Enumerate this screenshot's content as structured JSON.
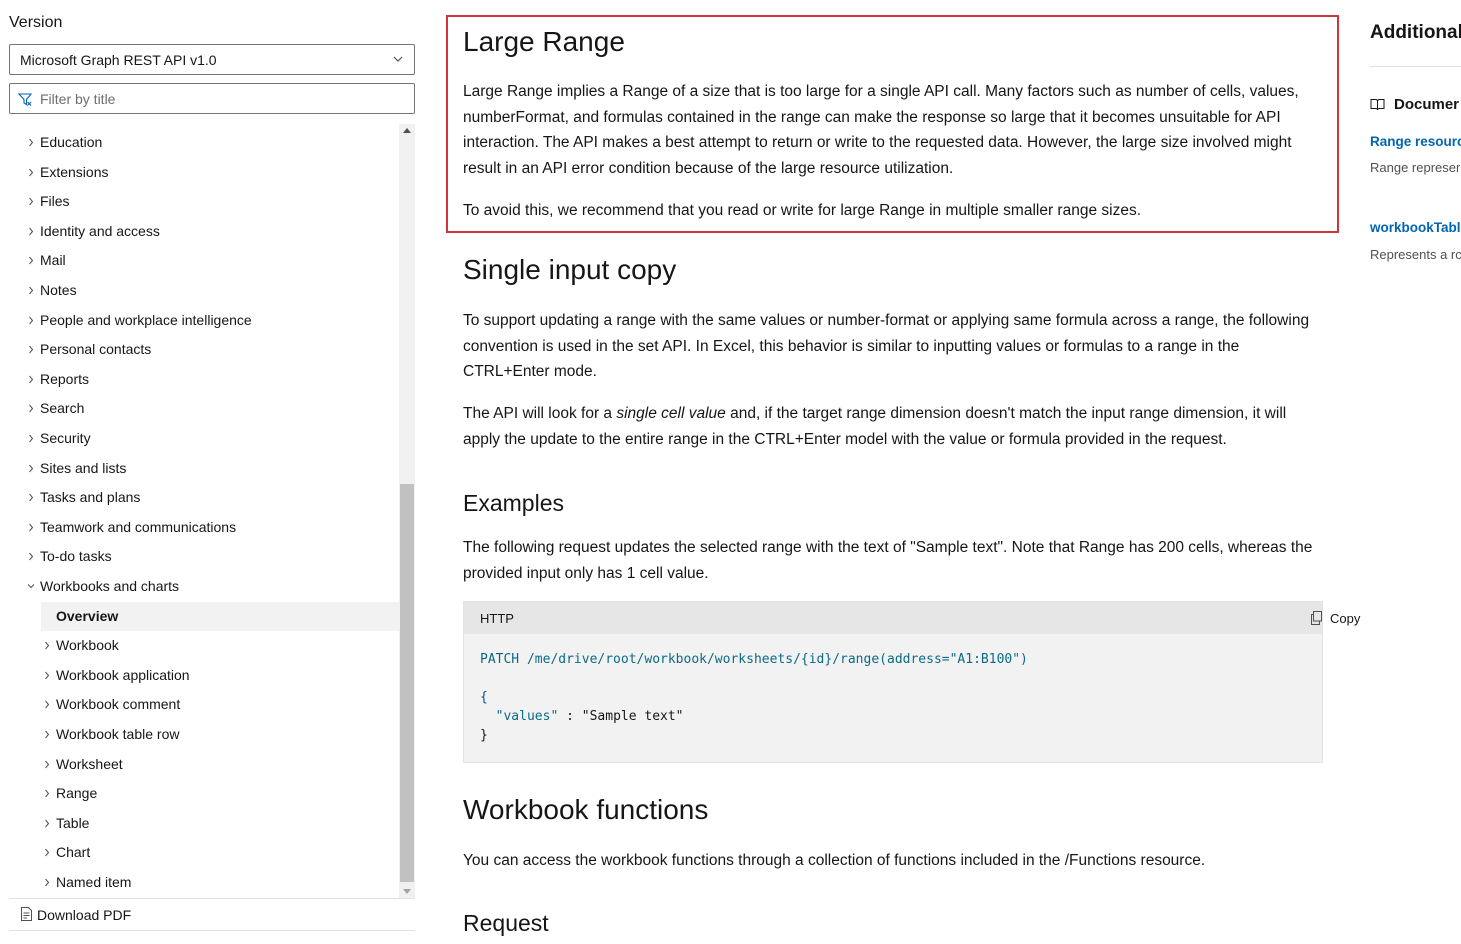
{
  "sidebar": {
    "version_label": "Version",
    "version_selected": "Microsoft Graph REST API v1.0",
    "filter_placeholder": "Filter by title",
    "toc": [
      {
        "label": "Education",
        "level": 1,
        "expanded": false,
        "selected": false
      },
      {
        "label": "Extensions",
        "level": 1,
        "expanded": false,
        "selected": false
      },
      {
        "label": "Files",
        "level": 1,
        "expanded": false,
        "selected": false
      },
      {
        "label": "Identity and access",
        "level": 1,
        "expanded": false,
        "selected": false
      },
      {
        "label": "Mail",
        "level": 1,
        "expanded": false,
        "selected": false
      },
      {
        "label": "Notes",
        "level": 1,
        "expanded": false,
        "selected": false
      },
      {
        "label": "People and workplace intelligence",
        "level": 1,
        "expanded": false,
        "selected": false
      },
      {
        "label": "Personal contacts",
        "level": 1,
        "expanded": false,
        "selected": false
      },
      {
        "label": "Reports",
        "level": 1,
        "expanded": false,
        "selected": false
      },
      {
        "label": "Search",
        "level": 1,
        "expanded": false,
        "selected": false
      },
      {
        "label": "Security",
        "level": 1,
        "expanded": false,
        "selected": false
      },
      {
        "label": "Sites and lists",
        "level": 1,
        "expanded": false,
        "selected": false
      },
      {
        "label": "Tasks and plans",
        "level": 1,
        "expanded": false,
        "selected": false
      },
      {
        "label": "Teamwork and communications",
        "level": 1,
        "expanded": false,
        "selected": false
      },
      {
        "label": "To-do tasks",
        "level": 1,
        "expanded": false,
        "selected": false
      },
      {
        "label": "Workbooks and charts",
        "level": 1,
        "expanded": true,
        "selected": false
      },
      {
        "label": "Overview",
        "level": 2,
        "expanded": false,
        "selected": true,
        "leaf": true
      },
      {
        "label": "Workbook",
        "level": 2,
        "expanded": false,
        "selected": false
      },
      {
        "label": "Workbook application",
        "level": 2,
        "expanded": false,
        "selected": false
      },
      {
        "label": "Workbook comment",
        "level": 2,
        "expanded": false,
        "selected": false
      },
      {
        "label": "Workbook table row",
        "level": 2,
        "expanded": false,
        "selected": false
      },
      {
        "label": "Worksheet",
        "level": 2,
        "expanded": false,
        "selected": false
      },
      {
        "label": "Range",
        "level": 2,
        "expanded": false,
        "selected": false
      },
      {
        "label": "Table",
        "level": 2,
        "expanded": false,
        "selected": false
      },
      {
        "label": "Chart",
        "level": 2,
        "expanded": false,
        "selected": false
      },
      {
        "label": "Named item",
        "level": 2,
        "expanded": false,
        "selected": false
      }
    ],
    "download_pdf": "Download PDF"
  },
  "main": {
    "large_range": {
      "heading": "Large Range",
      "p1": "Large Range implies a Range of a size that is too large for a single API call. Many factors such as number of cells, values, numberFormat, and formulas contained in the range can make the response so large that it becomes unsuitable for API interaction. The API makes a best attempt to return or write to the requested data. However, the large size involved might result in an API error condition because of the large resource utilization.",
      "p2": "To avoid this, we recommend that you read or write for large Range in multiple smaller range sizes."
    },
    "single_input": {
      "heading": "Single input copy",
      "p1": "To support updating a range with the same values or number-format or applying same formula across a range, the following convention is used in the set API. In Excel, this behavior is similar to inputting values or formulas to a range in the CTRL+Enter mode.",
      "p2_before": "The API will look for a ",
      "p2_em": "single cell value",
      "p2_after": " and, if the target range dimension doesn't match the input range dimension, it will apply the update to the entire range in the CTRL+Enter model with the value or formula provided in the request."
    },
    "examples": {
      "heading": "Examples",
      "p1": "The following request updates the selected range with the text of \"Sample text\". Note that Range has 200 cells, whereas the provided input only has 1 cell value.",
      "code_lang": "HTTP",
      "copy_label": "Copy",
      "code_line1_verb": "PATCH",
      "code_line1_path": " /me/drive/root/workbook/worksheets/{id}/range(address=\"A1:B100\")",
      "code_open": "{",
      "code_key": "\"values\"",
      "code_sep": " : ",
      "code_value": "\"Sample text\"",
      "code_close": "}"
    },
    "workbook_functions": {
      "heading": "Workbook functions",
      "p1": "You can access the workbook functions through a collection of functions included in the /Functions resource."
    },
    "request": {
      "heading": "Request"
    }
  },
  "rail": {
    "title": "Additional",
    "doc_heading": "Documer",
    "links": [
      {
        "label": "Range resourc",
        "desc": "Range represer cell, a row, a cc"
      },
      {
        "label": "workbookTabl",
        "desc": "Represents a rc"
      }
    ]
  },
  "colors": {
    "highlight_border": "#d13438",
    "link": "#0065b3",
    "code_bg": "#f2f2f2",
    "selected_bg": "#f2f2f2"
  }
}
